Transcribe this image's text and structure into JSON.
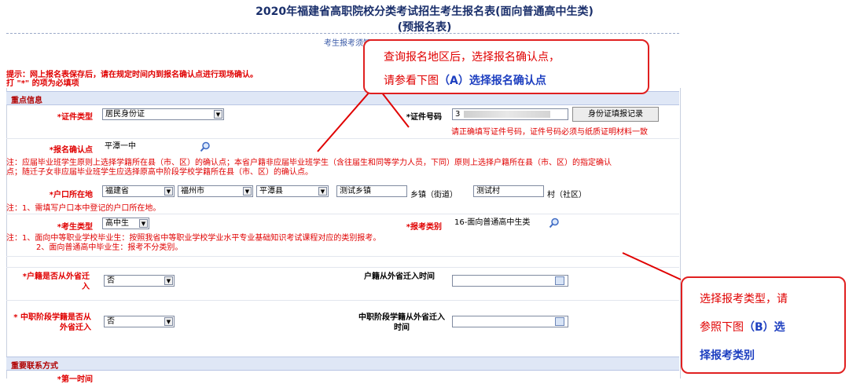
{
  "title": "2020年福建省高职院校分类考试招生考生报名表(面向普通高中生类)",
  "subtitle": "(预报名表)",
  "notice_link": "考生报考须知",
  "tips": [
    "提示：网上报名表保存后，请在规定时间内到报名确认点进行现场确认。",
    "打 \"*\" 的项为必填项"
  ],
  "section_key": "重点信息",
  "section_contact": "重要联系方式",
  "id_type": {
    "label": "*证件类型",
    "value": "居民身份证"
  },
  "id_number": {
    "label": "*证件号码",
    "value": "3",
    "button": "身份证填报记录",
    "hint": "请正确填写证件号码，证件号码必须与纸质证明材料一致"
  },
  "confirm_point": {
    "label": "*报名确认点",
    "value": "平潭一中"
  },
  "note_confirm": [
    "注：应届毕业班学生原则上选择学籍所在县（市、区）的确认点；本省户籍非应届毕业班学生（含往届生和同等学力人员，下同）原则上选择户籍所在县（市、区）的指定确认",
    "点；随迁子女非应届毕业班学生应选择原高中阶段学校学籍所在县（市、区）的确认点。"
  ],
  "household": {
    "label": "*户口所在地",
    "province": "福建省",
    "city": "福州市",
    "county": "平潭县",
    "town": "测试乡镇",
    "town_suffix": "乡镇（街道）",
    "village": "测试村",
    "village_suffix": "村（社区）"
  },
  "note_household": "注：1、需填写户口本中登记的户口所在地。",
  "student_type": {
    "label": "*考生类型",
    "value": "高中生"
  },
  "category": {
    "label": "*报考类别",
    "value": "16-面向普通高中生类"
  },
  "note_category": [
    "注：1、面向中等职业学校毕业生：按照我省中等职业学校学业水平专业基础知识考试课程对应的类别报考。",
    "2、面向普通高中毕业生：报考不分类别。"
  ],
  "hukou_moved": {
    "label": "*户籍是否从外省迁入",
    "value": "否"
  },
  "hukou_time": {
    "label": "户籍从外省迁入时间"
  },
  "school_moved": {
    "label": "* 中职阶段学籍是否从外省迁入",
    "value": "否"
  },
  "school_time": {
    "label": "中职阶段学籍从外省迁入时间"
  },
  "contact_first": "*第一时间",
  "callout_a": {
    "line1": "查询报名地区后，选择报名确认点，",
    "line2_pre": "请参看下图",
    "line2_b": "（A）选择报名确认点"
  },
  "callout_b": {
    "line1": "选择报考类型，请",
    "line2_pre": "参照下图",
    "line2_b": "（B）选",
    "line3": "择报考类别"
  },
  "colors": {
    "accent_red": "#e00000",
    "title_blue": "#1a2f6b",
    "section_bg": "#dfe7f6"
  }
}
